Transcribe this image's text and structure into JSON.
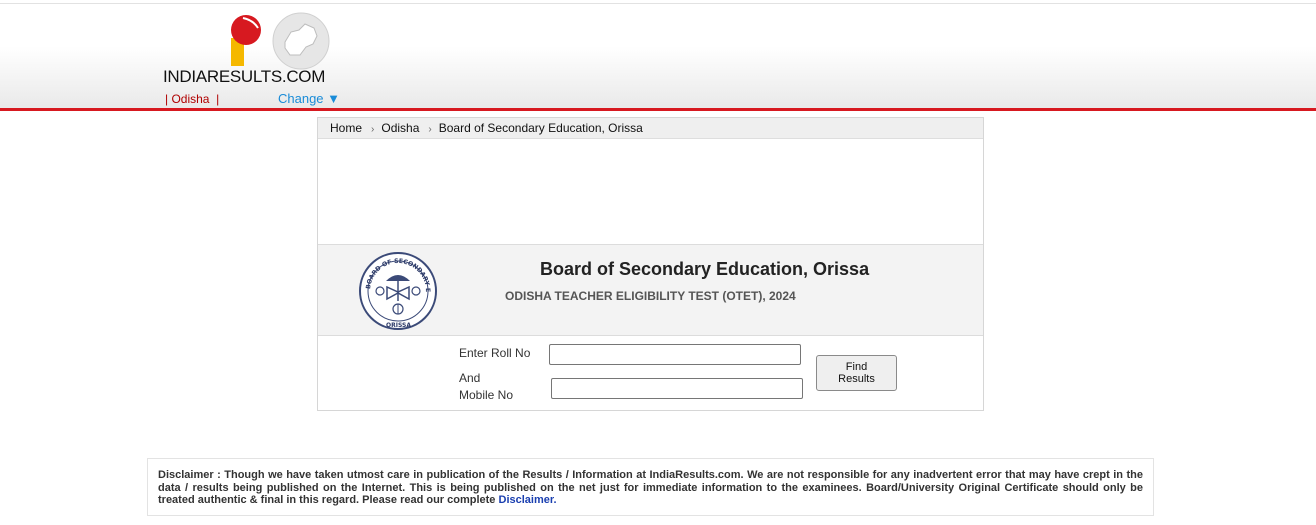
{
  "header": {
    "logo_text_prefix": "INDIA",
    "logo_text_middle": "RESULTS",
    "logo_text_suffix": ".COM",
    "state_label": "Odisha",
    "change_label": "Change ▼"
  },
  "breadcrumb": {
    "items": [
      "Home",
      "Odisha",
      "Board of Secondary Education, Orissa"
    ]
  },
  "board": {
    "title": "Board of Secondary Education, Orissa",
    "exam": "ODISHA TEACHER ELIGIBILITY TEST (OTET), 2024",
    "seal_top_text": "BOARD OF SECONDARY EDUCATION",
    "seal_bottom_text": "ORISSA"
  },
  "form": {
    "roll_label": "Enter Roll No",
    "and_label": "And",
    "mobile_label": "Mobile No",
    "roll_value": "",
    "mobile_value": "",
    "find_label_1": "Find",
    "find_label_2": "Results"
  },
  "disclaimer": {
    "text": "Disclaimer : Though we have taken utmost care in publication of the Results / Information at IndiaResults.com. We are not responsible for any inadvertent error that may have crept in the data / results being published on the Internet. This is being published on the net just for immediate information to the examinees. Board/University Original Certificate should only be treated authentic & final in this regard. Please read our complete",
    "link_label": "Disclaimer."
  },
  "colors": {
    "brand_red": "#d71920",
    "accent_yellow": "#f5b800",
    "link_blue": "#1a8cd8"
  }
}
